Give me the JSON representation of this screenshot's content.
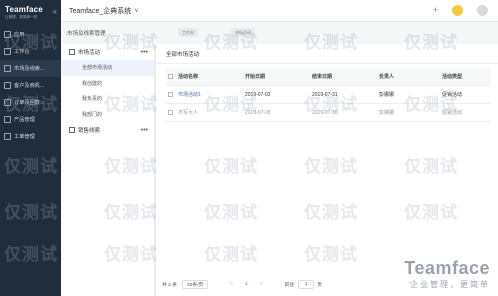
{
  "sidebar": {
    "logo_title": "Teamface",
    "logo_sub": "让管理，更简单一些",
    "collapse_glyph": "«",
    "items": [
      {
        "label": "应用"
      },
      {
        "label": "工作台"
      },
      {
        "label": "市场及线索..."
      },
      {
        "label": "客户及商机..."
      },
      {
        "label": "订单及回款..."
      },
      {
        "label": "产品管理"
      },
      {
        "label": "工单管理"
      }
    ]
  },
  "topbar": {
    "title": "Teamface_企典系统",
    "chevron": "∨",
    "plus": "+"
  },
  "breadcrumb": {
    "title": "市场及线索管理",
    "pill1": "工作台",
    "pill2": "市场活动"
  },
  "left_panel": {
    "group1": {
      "label": "市场活动",
      "more": "•••"
    },
    "sub_items": [
      {
        "label": "全部市场活动"
      },
      {
        "label": "我创建的"
      },
      {
        "label": "我负责的"
      },
      {
        "label": "我部门的"
      }
    ],
    "group2": {
      "label": "销售线索",
      "more": "•••"
    }
  },
  "main": {
    "title": "全部市场活动",
    "columns": [
      "活动名称",
      "开始日期",
      "结束日期",
      "负责人",
      "活动类型"
    ],
    "rows": [
      {
        "name": "市场活动1",
        "start": "2019-07-02",
        "end": "2019-07-31",
        "owner": "彭娜娜",
        "type": "促销活动"
      },
      {
        "name": "不写大人",
        "start": "2019-07-28",
        "end": "2019-07-30",
        "owner": "彭娜娜",
        "type": "促销活动"
      }
    ]
  },
  "pager": {
    "total": "共 2 条",
    "page_size": "20条/页",
    "prev": "<",
    "current": "1",
    "next": ">",
    "goto": "前往",
    "goto_value": "1",
    "unit": "页"
  },
  "watermark": {
    "text": "仅测试",
    "logo": "Teamface",
    "slogan": "企业管理，更简单"
  },
  "colors": {
    "sidebar_bg": "#1f2d3d",
    "accent": "#3a7bd5",
    "bell": "#f5c842"
  }
}
